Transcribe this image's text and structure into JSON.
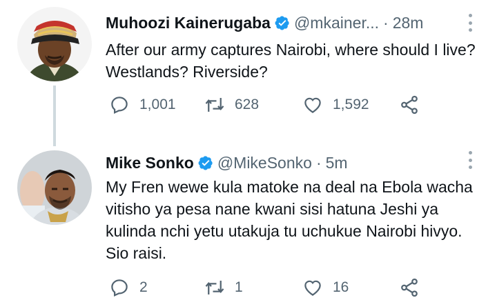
{
  "tweets": [
    {
      "name": "Muhoozi Kainerugaba",
      "handle": "@mkainer...",
      "separator": "·",
      "time": "28m",
      "text": "After our army captures Nairobi, where should I live? Westlands? Riverside?",
      "replies": "1,001",
      "retweets": "628",
      "likes": "1,592"
    },
    {
      "name": "Mike Sonko",
      "handle": "@MikeSonko",
      "separator": "·",
      "time": "5m",
      "text": "My Fren wewe kula matoke na deal na Ebola wacha vitisho ya pesa nane kwani sisi hatuna Jeshi ya kulinda nchi yetu utakuja tu uchukue Nairobi hivyo. Sio raisi.",
      "replies": "2",
      "retweets": "1",
      "likes": "16"
    }
  ],
  "colors": {
    "verified_blue": "#1d9bf0",
    "secondary_text": "#536471",
    "primary_text": "#0f1419",
    "thread_line": "#cfd9de"
  },
  "icons": [
    "reply-icon",
    "retweet-icon",
    "like-icon",
    "share-icon",
    "verified-badge-icon",
    "more-options-icon"
  ]
}
